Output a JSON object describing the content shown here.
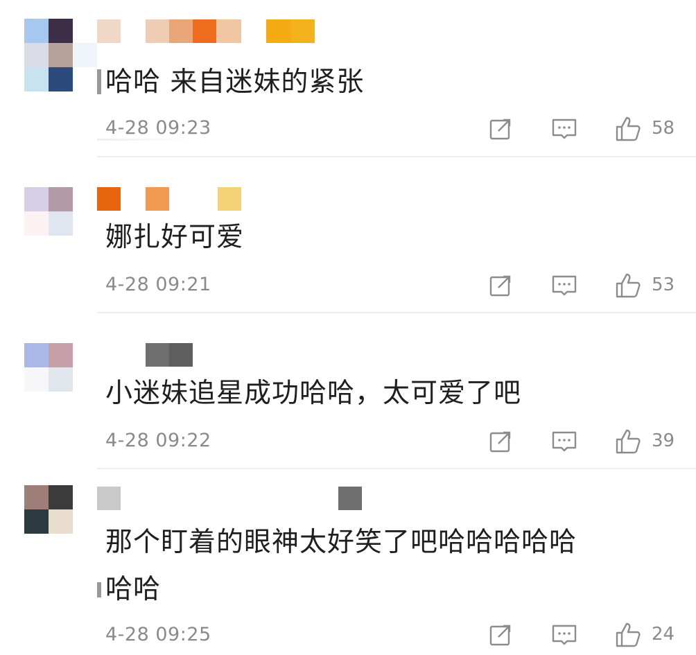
{
  "comments": [
    {
      "text": "哈哈 来自迷妹的紧张",
      "time": "4-28 09:23",
      "likes": "58",
      "avatar_colors": [
        "#a6c7ef",
        "#3d2e47",
        "#dcdce8",
        "#b6a29b",
        "#c7e3f1",
        "#2c4a7e"
      ],
      "name_colors": [
        "#f1d8c6",
        "#efcdb5",
        "#eaa679",
        "#ee6c1d",
        "#f0c6a3",
        "#f5ac12",
        "#f3b21c"
      ]
    },
    {
      "text": "娜扎好可爱",
      "time": "4-28 09:21",
      "likes": "53",
      "avatar_colors": [
        "#d7cfe8",
        "#b39aa6",
        "#fcf1f3",
        "#dfe6f0"
      ],
      "name_colors": [
        "#e8650f",
        "#f09a52",
        "#f6d277"
      ]
    },
    {
      "text": "小迷妹追星成功哈哈，太可爱了吧",
      "time": "4-28 09:22",
      "likes": "39",
      "avatar_colors": [
        "#a9b7e9",
        "#c6a0a9",
        "#f7f7fa",
        "#dfe6ec"
      ],
      "name_colors": [
        "#6f6f6f",
        "#5e5e5e"
      ]
    },
    {
      "text_line1": "那个盯着的眼神太好笑了吧哈哈哈哈哈",
      "text_line2": "哈哈",
      "time": "4-28 09:25",
      "likes": "24",
      "avatar_colors": [
        "#9e7e76",
        "#3b3b3b",
        "#2b3940",
        "#e8dccc"
      ],
      "name_colors": [
        "#c9c9c9",
        "#6e6e6e"
      ]
    }
  ],
  "icons": {
    "share": "share-icon",
    "reply": "comment-icon",
    "like": "thumbs-up-icon",
    "color": "#8c8c8c"
  }
}
